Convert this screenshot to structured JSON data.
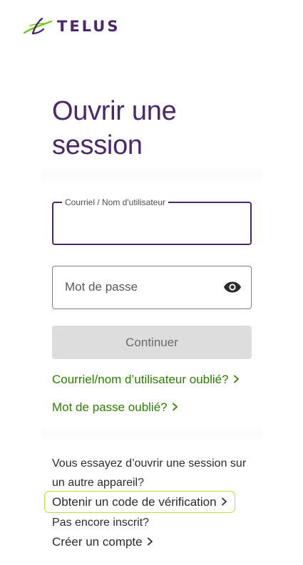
{
  "brand": {
    "name": "TELUS",
    "accent_color": "#4b286d",
    "link_color": "#2b8000"
  },
  "login": {
    "title_line1": "Ouvrir une",
    "title_line2": "session",
    "email_legend": "Courriel / Nom d'utilisateur",
    "email_value": "",
    "password_placeholder": "Mot de passe",
    "password_value": "",
    "show_password_icon": "eye-icon",
    "continue_label": "Continuer",
    "continue_disabled": true,
    "forgot_username_label": "Courriel/nom d’utilisateur oublié?",
    "forgot_password_label": "Mot de passe oublié?"
  },
  "other_device": {
    "prompt_line1": "Vous essayez d’ouvrir une session sur",
    "prompt_line2": "un autre appareil?",
    "verification_code_label": "Obtenir un code de vérification",
    "not_registered_text": "Pas encore inscrit?",
    "create_account_label": "Créer un compte"
  }
}
